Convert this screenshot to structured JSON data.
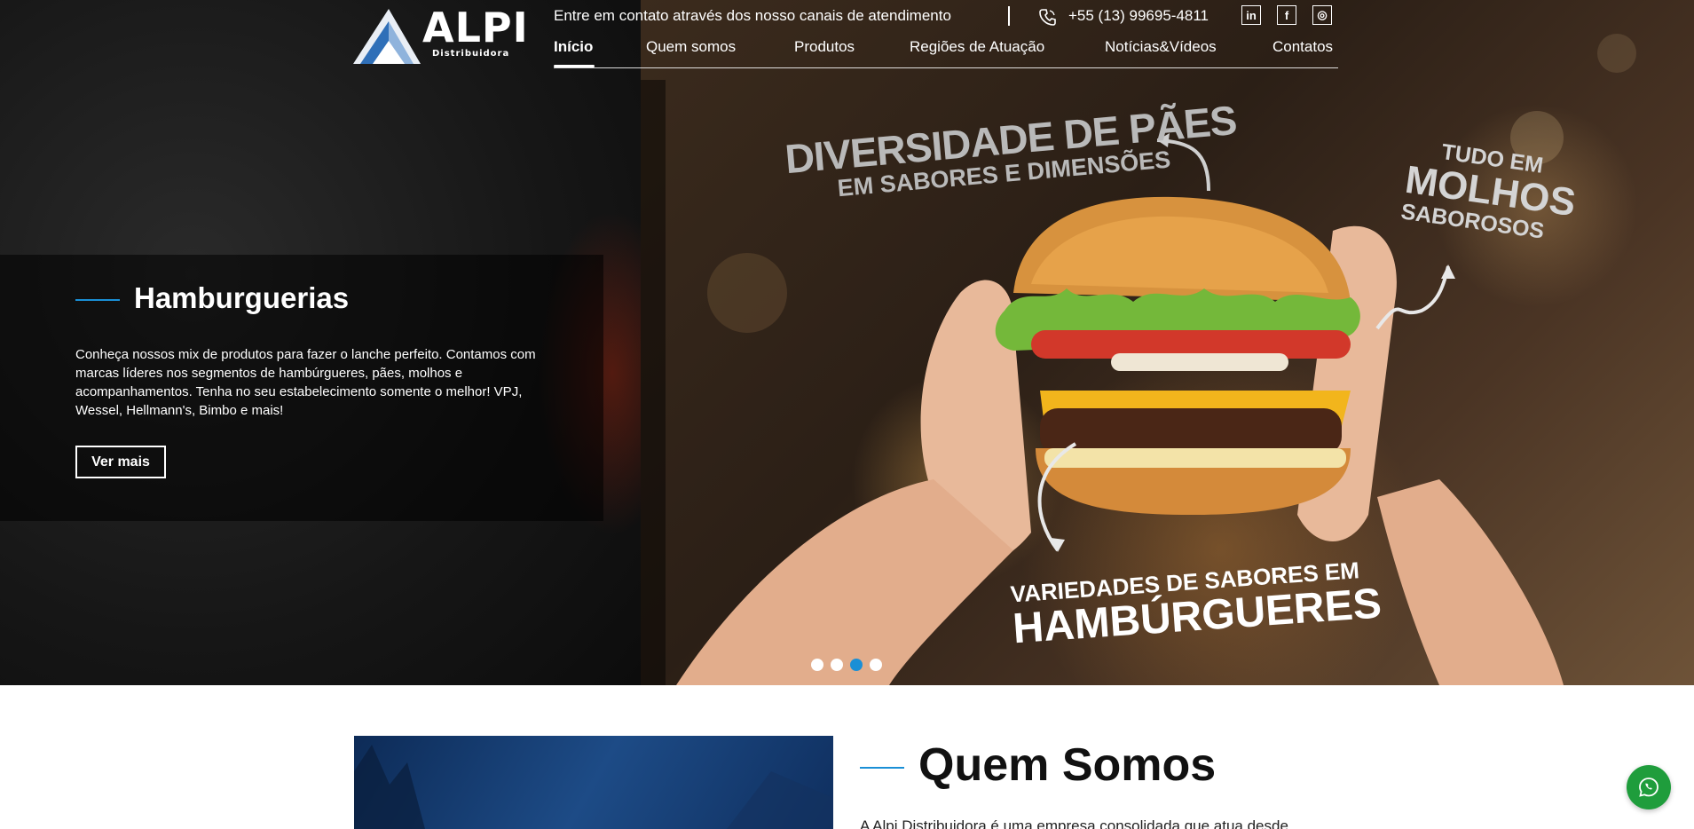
{
  "header": {
    "logo_text": "ALPI",
    "logo_sub": "Distribuidora",
    "contact_text": "Entre em contato através dos nosso canais de atendimento",
    "phone": "+55 (13) 99695-4811",
    "social": [
      {
        "icon": "linkedin-icon",
        "glyph": "in"
      },
      {
        "icon": "facebook-icon",
        "glyph": "f"
      },
      {
        "icon": "instagram-icon",
        "glyph": "◎"
      }
    ]
  },
  "nav": {
    "items": [
      {
        "label": "Início",
        "active": true
      },
      {
        "label": "Quem somos"
      },
      {
        "label": "Produtos"
      },
      {
        "label": "Regiões de Atuação"
      },
      {
        "label": "Notícias&Vídeos"
      },
      {
        "label": "Contatos"
      }
    ]
  },
  "hero": {
    "title": "Hamburguerias",
    "text": "Conheça nossos mix de produtos para fazer o lanche perfeito. Contamos com marcas líderes nos segmentos de hambúrgueres, pães, molhos e acompanhamentos. Tenha no seu estabelecimento somente o melhor! VPJ, Wessel, Hellmann's, Bimbo e mais!",
    "button": "Ver mais",
    "art_text_1a": "DIVERSIDADE DE PÃES",
    "art_text_1b": "EM SABORES E DIMENSÕES",
    "art_text_2a": "TUDO EM",
    "art_text_2b": "MOLHOS",
    "art_text_2c": "SABOROSOS",
    "art_text_3a": "VARIEDADES DE SABORES EM",
    "art_text_3b": "HAMBÚRGUERES",
    "slides": 4,
    "active_slide": 3
  },
  "about": {
    "title": "Quem Somos",
    "text": "A Alpi Distribuidora é uma empresa consolidada que atua desde"
  },
  "colors": {
    "accent": "#1a8fd6",
    "whatsapp": "#1f9d3c"
  }
}
